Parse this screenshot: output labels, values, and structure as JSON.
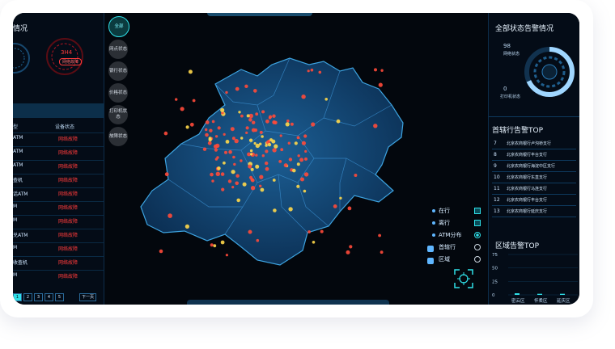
{
  "left": {
    "title": "情况",
    "gauge_left_value": "",
    "gauge_right_value": "3H4",
    "gauge_right_label": "网络故障",
    "section_bar": "",
    "col1": "型",
    "col2": "设备状态",
    "rows": [
      {
        "type": "ATM",
        "status": "网络故障"
      },
      {
        "type": "ATM",
        "status": "网络故障"
      },
      {
        "type": "ATM",
        "status": "网络故障"
      },
      {
        "type": "查机",
        "status": "网络故障"
      },
      {
        "type": "话ATM",
        "status": "网络故障"
      },
      {
        "type": "M",
        "status": "网络故障"
      },
      {
        "type": "M",
        "status": "网络故障"
      },
      {
        "type": "兑ATM",
        "status": "网络故障"
      },
      {
        "type": "M",
        "status": "网络故障"
      },
      {
        "type": "收查机",
        "status": "网络故障"
      },
      {
        "type": "M",
        "status": "网络故障"
      }
    ],
    "pages": [
      "1",
      "2",
      "3",
      "4",
      "5"
    ],
    "next": "下一页"
  },
  "tabs": [
    {
      "label": "全部",
      "active": true
    },
    {
      "label": "网点状态"
    },
    {
      "label": "银行状态"
    },
    {
      "label": "价格状态"
    },
    {
      "label": "打印机状态"
    },
    {
      "label": "故障状态"
    }
  ],
  "legend": [
    {
      "label": "在行",
      "icon": "dot-icon",
      "control": "checkbox"
    },
    {
      "label": "离行",
      "icon": "dot-icon",
      "control": "checkbox"
    },
    {
      "label": "ATM分布",
      "icon": "dot-icon",
      "control": "radio-on"
    },
    {
      "label": "首辖行",
      "icon": "bank-icon",
      "control": "radio"
    },
    {
      "label": "区域",
      "icon": "cloud-icon",
      "control": "radio"
    }
  ],
  "right": {
    "title": "全部状态告警情况",
    "stat1_value": "98",
    "stat1_label": "网络状态",
    "stat2_value": "0",
    "stat2_label": "打印机状态",
    "top_title": "首辖行告警TOP",
    "top_rows": [
      {
        "rank": "7",
        "name": "北京农商银行卢沟桥支行"
      },
      {
        "rank": "8",
        "name": "北京农商银行丰台支行"
      },
      {
        "rank": "9",
        "name": "北京农商银行海淀中区支行"
      },
      {
        "rank": "10",
        "name": "北京农商银行东直支行"
      },
      {
        "rank": "11",
        "name": "北京农商银行马连支行"
      },
      {
        "rank": "12",
        "name": "北京农商银行丰台支行"
      },
      {
        "rank": "13",
        "name": "北京农商银行延庆支行"
      }
    ],
    "area_title": "区域告警TOP",
    "chart_data": {
      "type": "bar",
      "title": "区域告警TOP",
      "y_ticks": [
        "75",
        "50",
        "25",
        "0"
      ],
      "ylim": [
        0,
        75
      ],
      "categories": [
        "密云区",
        "怀柔区",
        "延庆区"
      ],
      "values": [
        3,
        2,
        2
      ]
    }
  },
  "colors": {
    "accent": "#2fe0e8",
    "alarm": "#ff3b3b",
    "map": "#0f3b66"
  }
}
